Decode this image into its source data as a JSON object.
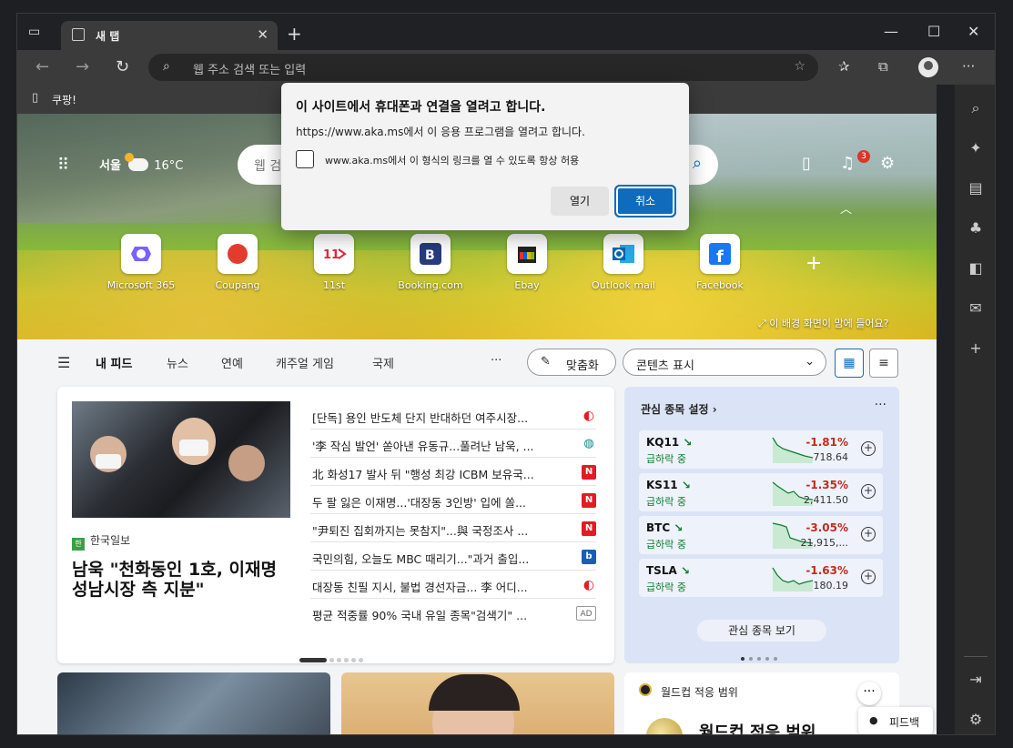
{
  "browser": {
    "tab_title": "새 탭",
    "address_placeholder": "웹 주소 검색 또는 입력",
    "favorites": [
      {
        "label": "쿠팡!"
      }
    ]
  },
  "dialog": {
    "title": "이 사이트에서 휴대폰과 연결을 열려고 합니다.",
    "message": "https://www.aka.ms에서 이 응용 프로그램을 열려고 합니다.",
    "checkbox_label": "www.aka.ms에서 이 형식의 링크를 열 수 있도록 항상 허용",
    "checkbox_checked": false,
    "open_label": "열기",
    "cancel_label": "취소"
  },
  "hero": {
    "city": "서울",
    "temp": "16°C",
    "search_placeholder": "웹 검",
    "notification_count": "3",
    "caption": "이 배경 화면이 맘에 들어요?",
    "shortcuts": [
      {
        "label": "Microsoft 365",
        "icon": "microsoft365-icon"
      },
      {
        "label": "Coupang",
        "icon": "coupang-icon"
      },
      {
        "label": "11st",
        "icon": "11st-icon"
      },
      {
        "label": "Booking.com",
        "icon": "booking-icon"
      },
      {
        "label": "Ebay",
        "icon": "ebay-icon"
      },
      {
        "label": "Outlook mail",
        "icon": "outlook-icon"
      },
      {
        "label": "Facebook",
        "icon": "facebook-icon"
      }
    ]
  },
  "feednav": {
    "items": [
      "내 피드",
      "뉴스",
      "연예",
      "캐주얼 게임",
      "국제"
    ],
    "more": "···",
    "personalize": "맞춤화",
    "content_view": "콘텐츠 표시"
  },
  "main_story": {
    "source": "한국일보",
    "headline": "남욱 \"천화동인 1호, 이재명 성남시장 측 지분\"",
    "items": [
      {
        "text": "[단독] 용인 반도체 단지 반대하던 여주시장...",
        "icon": "c"
      },
      {
        "text": "'李 작심 발언' 쏟아낸 유동규...풀려난 남욱, ...",
        "icon": "globe"
      },
      {
        "text": "北 화성17 발사 뒤 \"행성 최강 ICBM 보유국...",
        "icon": "N"
      },
      {
        "text": "두 팔 잃은 이재명...'대장동 3인방' 입에 쏠...",
        "icon": "N"
      },
      {
        "text": "\"尹퇴진 집회까지는 못참지\"...與 국정조사 ...",
        "icon": "N"
      },
      {
        "text": "국민의힘, 오늘도 MBC 때리기...\"과거 출입...",
        "icon": "blue"
      },
      {
        "text": "대장동 친필 지시, 불법 경선자금... 李 어디...",
        "icon": "c"
      },
      {
        "text": "평균 적중률 90% 국내 유일 종목\"검색기\" ...",
        "icon": "AD"
      }
    ]
  },
  "stocks": {
    "header": "관심 종목 설정",
    "button": "관심 종목 보기",
    "rows": [
      {
        "symbol": "KQ11",
        "status": "급하락 중",
        "change": "-1.81%",
        "value": "718.64"
      },
      {
        "symbol": "KS11",
        "status": "급하락 중",
        "change": "-1.35%",
        "value": "2,411.50"
      },
      {
        "symbol": "BTC",
        "status": "급하락 중",
        "change": "-3.05%",
        "value": "21,915,..."
      },
      {
        "symbol": "TSLA",
        "status": "급하락 중",
        "change": "-1.63%",
        "value": "180.19"
      }
    ]
  },
  "worldcup": {
    "label": "월드컵 적응 범위",
    "big": "월드컵 적응 범위"
  },
  "feedback": "피드백",
  "colors": {
    "accent": "#0f6cbd",
    "down": "#c42b1c",
    "green": "#0a7d2c"
  }
}
